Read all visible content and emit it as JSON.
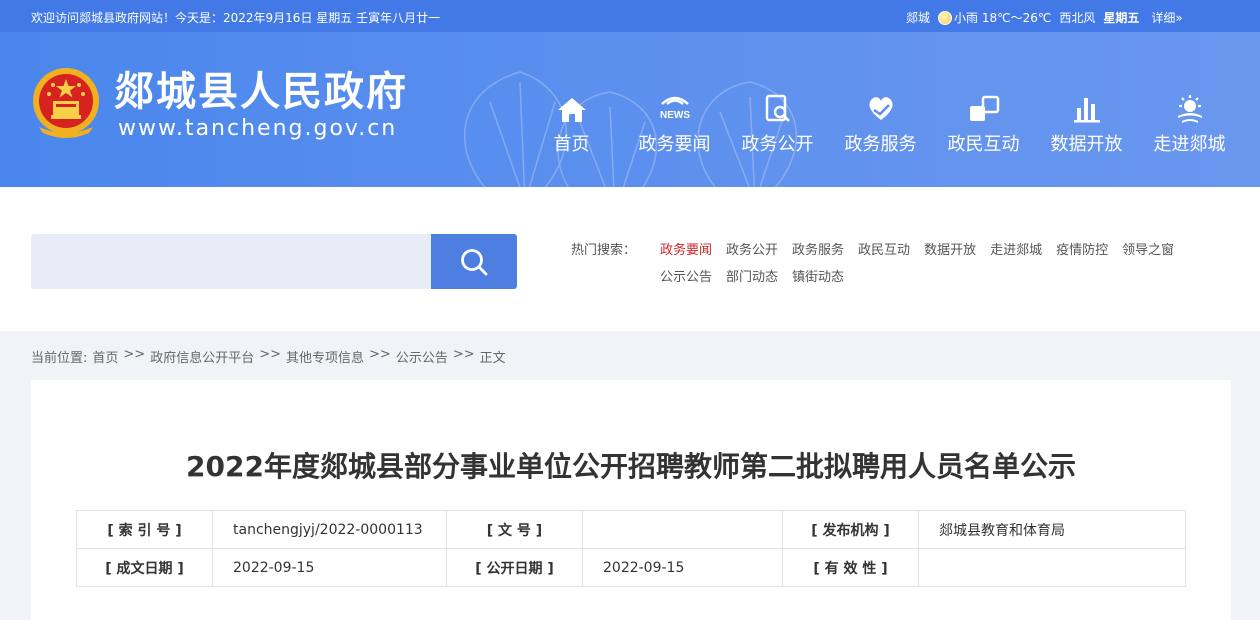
{
  "topbar": {
    "welcome": "欢迎访问郯城县政府网站！今天是：2022年9月16日  星期五  壬寅年八月廿一",
    "weather_city": "郯城",
    "weather_desc": "小雨 18℃～26℃",
    "weather_wind": "西北风",
    "weather_day": "星期五",
    "weather_more": "详细»"
  },
  "header": {
    "site_title": "郯城县人民政府",
    "site_url": "www.tancheng.gov.cn",
    "news_badge": "NEWS",
    "nav": [
      {
        "label": "首页",
        "icon": "home-icon"
      },
      {
        "label": "政务要闻",
        "icon": "news-icon"
      },
      {
        "label": "政务公开",
        "icon": "document-search-icon"
      },
      {
        "label": "政务服务",
        "icon": "heart-hand-icon"
      },
      {
        "label": "政民互动",
        "icon": "interaction-icon"
      },
      {
        "label": "数据开放",
        "icon": "bar-chart-icon"
      },
      {
        "label": "走进郯城",
        "icon": "weather-sun-icon"
      }
    ]
  },
  "search": {
    "placeholder": "",
    "hot_label": "热门搜索：",
    "hot_links_row1": [
      "政务要闻",
      "政务公开",
      "政务服务",
      "政民互动",
      "数据开放",
      "走进郯城",
      "疫情防控",
      "领导之窗"
    ],
    "hot_links_row2": [
      "公示公告",
      "部门动态",
      "镇街动态"
    ]
  },
  "breadcrumb": {
    "prefix": "当前位置:",
    "items": [
      "首页",
      "政府信息公开平台",
      "其他专项信息",
      "公示公告",
      "正文"
    ],
    "separator": ">>"
  },
  "article": {
    "title": "2022年度郯城县部分事业单位公开招聘教师第二批拟聘用人员名单公示",
    "meta": {
      "index_key": "[ 索  引  号 ]",
      "index_val": "tanchengjyj/2022-0000113",
      "docno_key": "[ 文      号 ]",
      "docno_val": "",
      "publisher_key": "[ 发布机构 ]",
      "publisher_val": "郯城县教育和体育局",
      "created_key": "[ 成文日期 ]",
      "created_val": "2022-09-15",
      "published_key": "[ 公开日期 ]",
      "published_val": "2022-09-15",
      "validity_key": "[ 有  效  性 ]",
      "validity_val": ""
    }
  },
  "colors": {
    "topbar": "#4279e6",
    "header": "#5b8fee",
    "search_button": "#4d7fe0",
    "hot_active": "#d0262a"
  }
}
